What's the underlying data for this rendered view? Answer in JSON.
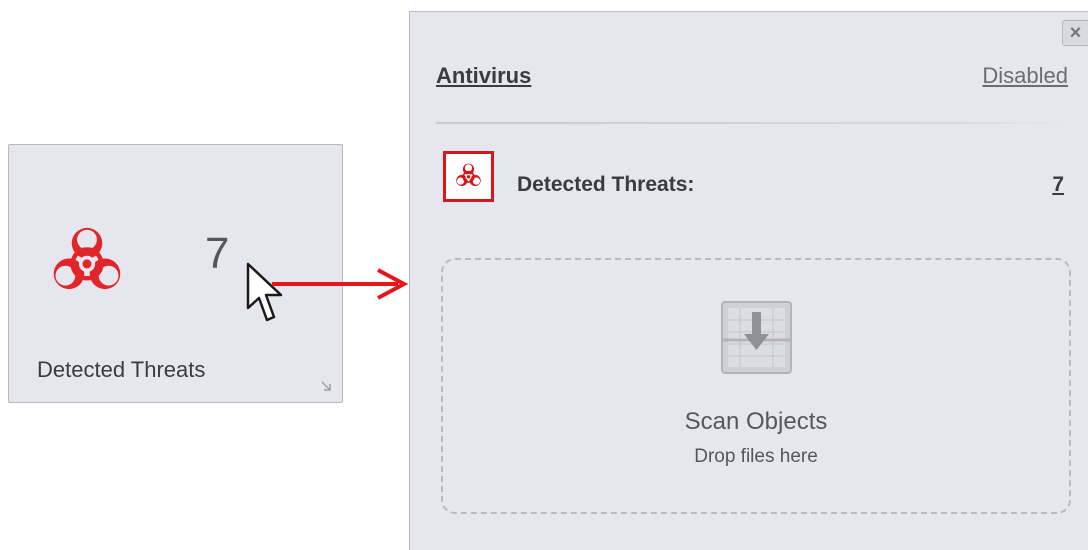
{
  "tile": {
    "count": "7",
    "label": "Detected Threats",
    "icon": "biohazard-icon",
    "expand_icon": "expand-corner-icon"
  },
  "panel": {
    "title": "Antivirus",
    "status": "Disabled",
    "close_icon": "close-icon",
    "threats": {
      "label": "Detected Threats:",
      "count": "7",
      "icon": "biohazard-icon"
    },
    "dropzone": {
      "title": "Scan Objects",
      "subtitle": "Drop files here",
      "icon": "download-drop-icon"
    }
  },
  "colors": {
    "accent_red": "#d8161b",
    "panel_bg": "#e6e7ee",
    "text_dark": "#3a3b40",
    "text_muted": "#6b6d74"
  }
}
